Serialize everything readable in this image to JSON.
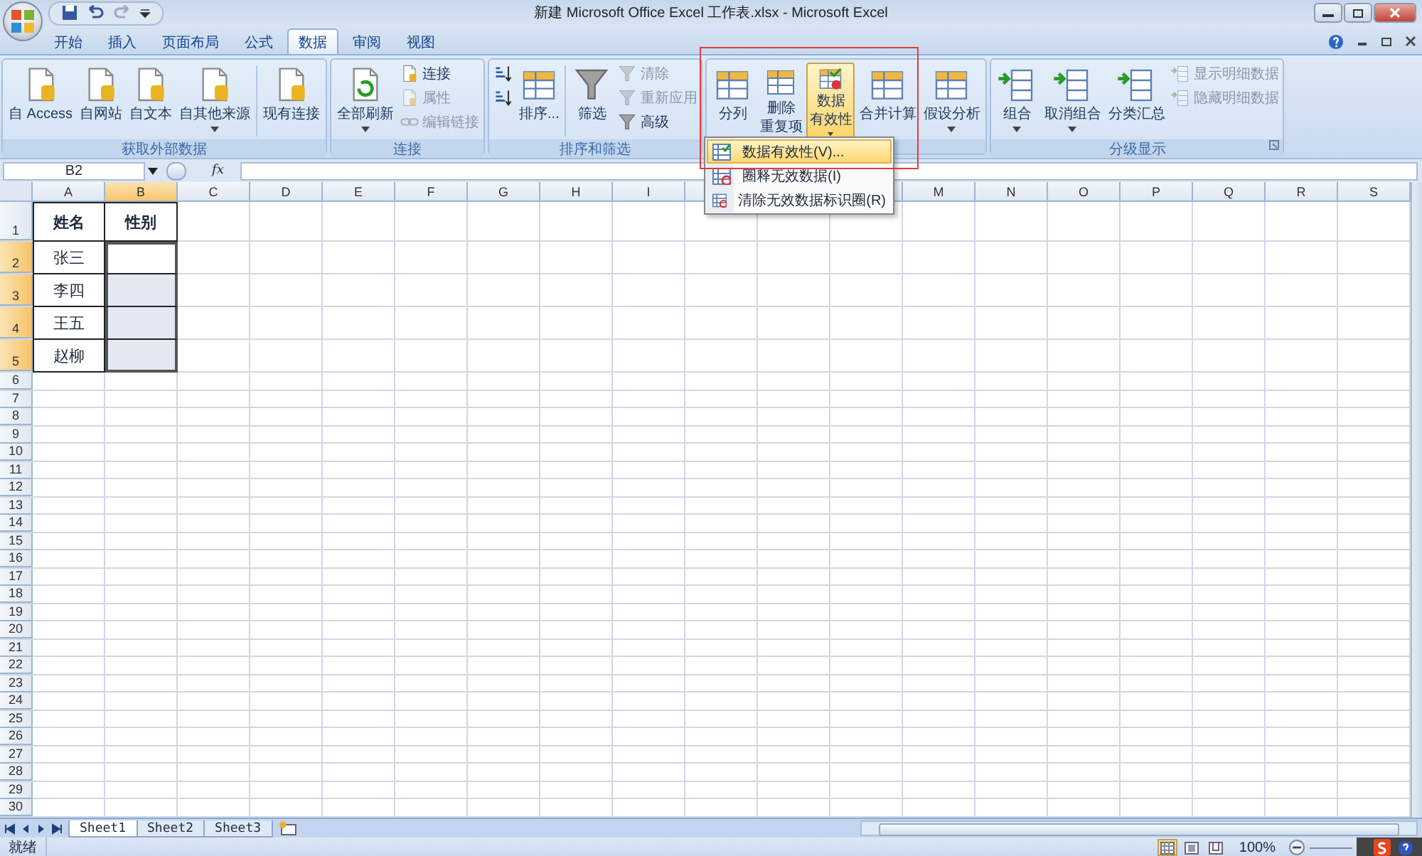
{
  "title": "新建 Microsoft Office Excel 工作表.xlsx - Microsoft Excel",
  "tabs": [
    {
      "label": "开始",
      "selected": false
    },
    {
      "label": "插入",
      "selected": false
    },
    {
      "label": "页面布局",
      "selected": false
    },
    {
      "label": "公式",
      "selected": false
    },
    {
      "label": "数据",
      "selected": true
    },
    {
      "label": "审阅",
      "selected": false
    },
    {
      "label": "视图",
      "selected": false
    }
  ],
  "ribbon": {
    "groups": [
      {
        "label": "获取外部数据",
        "items": [
          {
            "kind": "large",
            "label": "自 Access",
            "dropdown": false,
            "pressed": false
          },
          {
            "kind": "large",
            "label": "自网站",
            "dropdown": false,
            "pressed": false
          },
          {
            "kind": "large",
            "label": "自文本",
            "dropdown": false,
            "pressed": false
          },
          {
            "kind": "large",
            "label": "自其他来源",
            "dropdown": true,
            "pressed": false
          },
          {
            "kind": "separator"
          },
          {
            "kind": "large",
            "label": "现有连接",
            "dropdown": false,
            "pressed": false
          }
        ]
      },
      {
        "label": "连接",
        "items": [
          {
            "kind": "large",
            "label": "全部刷新",
            "dropdown": true,
            "pressed": false
          },
          {
            "kind": "stack",
            "buttons": [
              {
                "label": "连接",
                "disabled": false
              },
              {
                "label": "属性",
                "disabled": true
              },
              {
                "label": "编辑链接",
                "disabled": true
              }
            ]
          }
        ]
      },
      {
        "label": "排序和筛选",
        "items": [
          {
            "kind": "stack",
            "buttons": [
              {
                "disabled": false
              },
              {
                "disabled": false
              }
            ]
          },
          {
            "kind": "large",
            "label": "排序...",
            "dropdown": false,
            "pressed": false
          },
          {
            "kind": "separator"
          },
          {
            "kind": "large",
            "label": "筛选",
            "dropdown": false,
            "pressed": false
          },
          {
            "kind": "stack",
            "buttons": [
              {
                "label": "清除",
                "disabled": true
              },
              {
                "label": "重新应用",
                "disabled": true
              },
              {
                "label": "高级",
                "disabled": false
              }
            ]
          }
        ]
      },
      {
        "items": [
          {
            "kind": "large",
            "label": "分列",
            "dropdown": false,
            "pressed": false
          },
          {
            "kind": "large",
            "lines": [
              "删除",
              "重复项"
            ],
            "dropdown": false,
            "pressed": false
          },
          {
            "kind": "large",
            "lines": [
              "数据",
              "有效性"
            ],
            "dropdown": true,
            "pressed": true
          },
          {
            "kind": "large",
            "label": "合并计算",
            "dropdown": false,
            "pressed": false
          },
          {
            "kind": "large",
            "label": "假设分析",
            "dropdown": true,
            "pressed": false
          }
        ]
      },
      {
        "label": "分级显示",
        "items": [
          {
            "kind": "large",
            "label": "组合",
            "dropdown": true,
            "pressed": false
          },
          {
            "kind": "large",
            "label": "取消组合",
            "dropdown": true,
            "pressed": false
          },
          {
            "kind": "large",
            "label": "分类汇总",
            "dropdown": false,
            "pressed": false
          },
          {
            "kind": "stack",
            "buttons": [
              {
                "label": "显示明细数据",
                "disabled": true
              },
              {
                "label": "隐藏明细数据",
                "disabled": true
              }
            ]
          }
        ]
      }
    ]
  },
  "menu": {
    "items": [
      {
        "label": "数据有效性(V)...",
        "selected": true
      },
      {
        "label": "圈释无效数据(I)",
        "selected": false
      },
      {
        "label": "清除无效数据标识圈(R)",
        "selected": false
      }
    ]
  },
  "highlight_frame": true,
  "formula_bar": {
    "name_box": "B2",
    "function_label": "fx"
  },
  "sheet": {
    "columns": [
      {
        "label": "A",
        "selected": false
      },
      {
        "label": "B",
        "selected": true
      },
      {
        "label": "C",
        "selected": false
      },
      {
        "label": "D",
        "selected": false
      },
      {
        "label": "E",
        "selected": false
      },
      {
        "label": "F",
        "selected": false
      },
      {
        "label": "G",
        "selected": false
      },
      {
        "label": "H",
        "selected": false
      },
      {
        "label": "I",
        "selected": false
      },
      {},
      {},
      {},
      {
        "label": "M",
        "selected": false
      },
      {
        "label": "N",
        "selected": false
      },
      {
        "label": "O",
        "selected": false
      },
      {
        "label": "P",
        "selected": false
      },
      {
        "label": "Q",
        "selected": false
      },
      {
        "label": "R",
        "selected": false
      },
      {
        "label": "S",
        "selected": false
      }
    ],
    "rows": [
      {
        "label": "1",
        "selected": false,
        "cells": [
          {
            "text": "姓名",
            "selected": false
          },
          {
            "text": "性别",
            "selected": false
          }
        ]
      },
      {
        "label": "2",
        "selected": true,
        "cells": [
          {
            "text": "张三",
            "selected": false
          },
          {
            "selected": true,
            "active": true
          }
        ]
      },
      {
        "label": "3",
        "selected": true,
        "cells": [
          {
            "text": "李四",
            "selected": false
          },
          {
            "selected": true,
            "active": false
          }
        ]
      },
      {
        "label": "4",
        "selected": true,
        "cells": [
          {
            "text": "王五",
            "selected": false
          },
          {
            "selected": true,
            "active": false
          }
        ]
      },
      {
        "label": "5",
        "selected": true,
        "cells": [
          {
            "text": "赵柳",
            "selected": false
          },
          {
            "selected": true,
            "active": false
          }
        ]
      },
      {
        "label": "6",
        "selected": false
      },
      {
        "label": "7",
        "selected": false
      },
      {
        "label": "8",
        "selected": false
      },
      {
        "label": "9",
        "selected": false
      },
      {
        "label": "10",
        "selected": false
      },
      {
        "label": "11",
        "selected": false
      },
      {
        "label": "12",
        "selected": false
      },
      {
        "label": "13",
        "selected": false
      },
      {
        "label": "14",
        "selected": false
      },
      {
        "label": "15",
        "selected": false
      },
      {
        "label": "16",
        "selected": false
      },
      {
        "label": "17",
        "selected": false
      },
      {
        "label": "18",
        "selected": false
      },
      {
        "label": "19",
        "selected": false
      },
      {
        "label": "20",
        "selected": false
      },
      {
        "label": "21",
        "selected": false
      },
      {
        "label": "22",
        "selected": false
      },
      {
        "label": "23",
        "selected": false
      },
      {
        "label": "24",
        "selected": false
      },
      {
        "label": "25",
        "selected": false
      },
      {
        "label": "26",
        "selected": false
      },
      {
        "label": "27",
        "selected": false
      },
      {
        "label": "28",
        "selected": false
      },
      {
        "label": "29",
        "selected": false
      },
      {
        "label": "30",
        "selected": false
      }
    ]
  },
  "sheet_tabs": [
    {
      "label": "Sheet1",
      "selected": true
    },
    {
      "label": "Sheet2",
      "selected": false
    },
    {
      "label": "Sheet3",
      "selected": false
    }
  ],
  "status_bar": {
    "text": "就绪",
    "view_buttons": [
      {
        "selected": true
      },
      {
        "selected": false
      },
      {
        "selected": false
      }
    ],
    "zoom": "100%"
  }
}
